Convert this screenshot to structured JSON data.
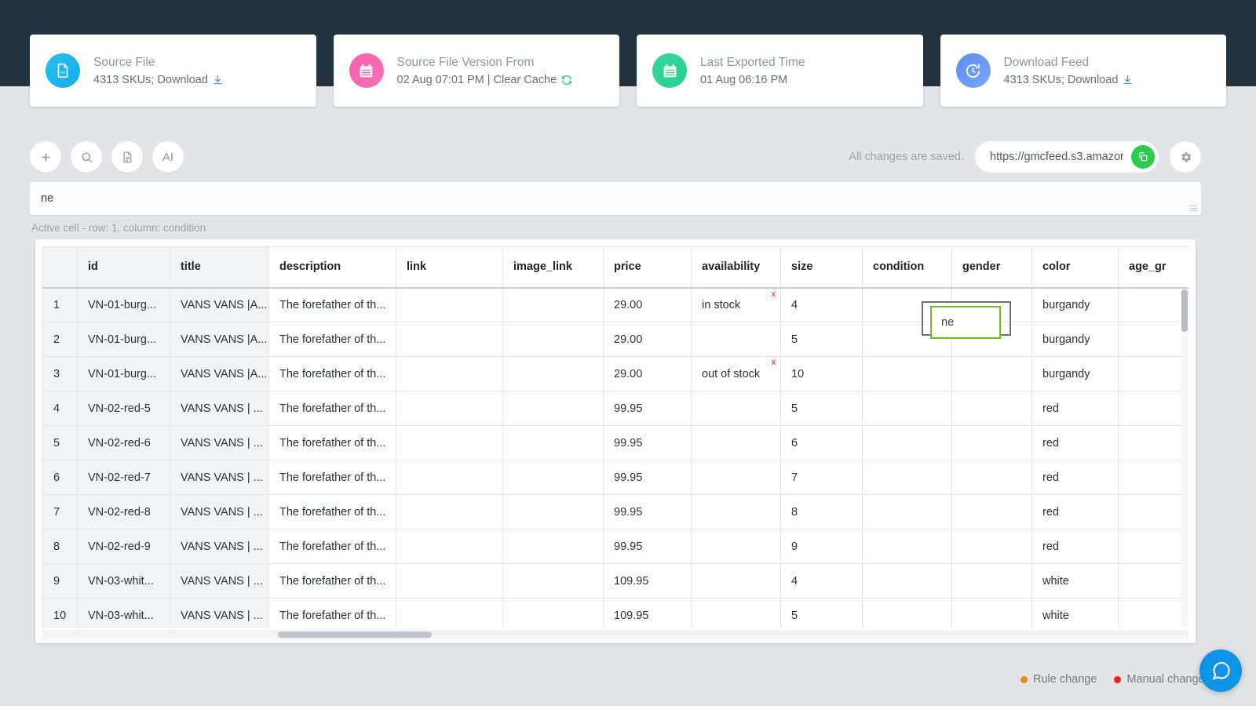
{
  "cards": [
    {
      "icon": "csv-file-icon",
      "title": "Source File",
      "subtitle": "4313 SKUs; Download",
      "action_icon": "download-icon",
      "color": "#12aee8"
    },
    {
      "icon": "calendar-icon",
      "title": "Source File Version From",
      "subtitle": "02 Aug 07:01 PM | Clear Cache",
      "action_icon": "refresh-icon",
      "color": "#f472b6"
    },
    {
      "icon": "calendar-icon",
      "title": "Last Exported Time",
      "subtitle": "01 Aug 06:16 PM",
      "action_icon": "",
      "color": "#27cf8d"
    },
    {
      "icon": "history-clock-icon",
      "title": "Download Feed",
      "subtitle": "4313 SKUs;  Download",
      "action_icon": "download-icon",
      "color": "#5b8def"
    }
  ],
  "toolbar": {
    "buttons": [
      {
        "name": "add-button",
        "icon": "plus-icon",
        "label": ""
      },
      {
        "name": "search-button",
        "icon": "search-icon",
        "label": ""
      },
      {
        "name": "document-button",
        "icon": "document-icon",
        "label": ""
      },
      {
        "name": "ai-button",
        "icon": "ai-icon",
        "label": "AI"
      }
    ],
    "saved_status": "All changes are saved.",
    "feed_url": "https://gmcfeed.s3.amazor",
    "copy_icon": "copy-icon",
    "settings_icon": "gear-icon"
  },
  "formula": {
    "value": "ne",
    "active_cell_note": "Active cell - row: 1, column: condition"
  },
  "sheet": {
    "columns": [
      "id",
      "title",
      "description",
      "link",
      "image_link",
      "price",
      "availability",
      "size",
      "condition",
      "gender",
      "color",
      "age_gr"
    ],
    "rows": [
      {
        "n": "1",
        "id": "VN-01-burg...",
        "title": "VANS VANS |A...",
        "description": "The forefather of th...",
        "link": "",
        "image_link": "",
        "price": "29.00",
        "availability": "in stock",
        "availability_flag": "x",
        "size": "4",
        "condition": "",
        "gender": "",
        "color": "burgandy",
        "age_group": ""
      },
      {
        "n": "2",
        "id": "VN-01-burg...",
        "title": "VANS VANS |A...",
        "description": "The forefather of th...",
        "link": "",
        "image_link": "",
        "price": "29.00",
        "availability": "",
        "availability_flag": "",
        "size": "5",
        "condition": "",
        "gender": "",
        "color": "burgandy",
        "age_group": ""
      },
      {
        "n": "3",
        "id": "VN-01-burg...",
        "title": "VANS VANS |A...",
        "description": "The forefather of th...",
        "link": "",
        "image_link": "",
        "price": "29.00",
        "availability": "out of stock",
        "availability_flag": "x",
        "size": "10",
        "condition": "",
        "gender": "",
        "color": "burgandy",
        "age_group": ""
      },
      {
        "n": "4",
        "id": "VN-02-red-5",
        "title": "VANS VANS | ...",
        "description": "The forefather of th...",
        "link": "",
        "image_link": "",
        "price": "99.95",
        "availability": "",
        "availability_flag": "",
        "size": "5",
        "condition": "",
        "gender": "",
        "color": "red",
        "age_group": ""
      },
      {
        "n": "5",
        "id": "VN-02-red-6",
        "title": "VANS VANS | ...",
        "description": "The forefather of th...",
        "link": "",
        "image_link": "",
        "price": "99.95",
        "availability": "",
        "availability_flag": "",
        "size": "6",
        "condition": "",
        "gender": "",
        "color": "red",
        "age_group": ""
      },
      {
        "n": "6",
        "id": "VN-02-red-7",
        "title": "VANS VANS | ...",
        "description": "The forefather of th...",
        "link": "",
        "image_link": "",
        "price": "99.95",
        "availability": "",
        "availability_flag": "",
        "size": "7",
        "condition": "",
        "gender": "",
        "color": "red",
        "age_group": ""
      },
      {
        "n": "7",
        "id": "VN-02-red-8",
        "title": "VANS VANS | ...",
        "description": "The forefather of th...",
        "link": "",
        "image_link": "",
        "price": "99.95",
        "availability": "",
        "availability_flag": "",
        "size": "8",
        "condition": "",
        "gender": "",
        "color": "red",
        "age_group": ""
      },
      {
        "n": "8",
        "id": "VN-02-red-9",
        "title": "VANS VANS | ...",
        "description": "The forefather of th...",
        "link": "",
        "image_link": "",
        "price": "99.95",
        "availability": "",
        "availability_flag": "",
        "size": "9",
        "condition": "",
        "gender": "",
        "color": "red",
        "age_group": ""
      },
      {
        "n": "9",
        "id": "VN-03-whit...",
        "title": "VANS VANS | ...",
        "description": "The forefather of th...",
        "link": "",
        "image_link": "",
        "price": "109.95",
        "availability": "",
        "availability_flag": "",
        "size": "4",
        "condition": "",
        "gender": "",
        "color": "white",
        "age_group": ""
      },
      {
        "n": "10",
        "id": "VN-03-whit...",
        "title": "VANS VANS | ...",
        "description": "The forefather of th...",
        "link": "",
        "image_link": "",
        "price": "109.95",
        "availability": "",
        "availability_flag": "",
        "size": "5",
        "condition": "",
        "gender": "",
        "color": "white",
        "age_group": ""
      }
    ],
    "editing_cell_value": "ne"
  },
  "legend": [
    {
      "label": "Rule change",
      "color": "#f0851f"
    },
    {
      "label": "Manual change",
      "color": "#f01c1c"
    }
  ],
  "help": {
    "icon": "chat-bubble-icon"
  }
}
